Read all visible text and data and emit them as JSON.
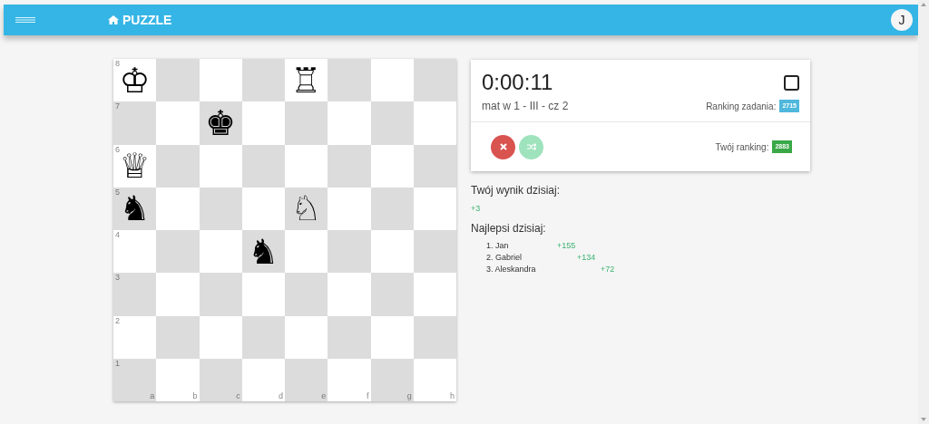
{
  "header": {
    "title": "PUZZLE",
    "avatar": "J"
  },
  "board": {
    "ranks": [
      "8",
      "7",
      "6",
      "5",
      "4",
      "3",
      "2",
      "1"
    ],
    "files": [
      "a",
      "b",
      "c",
      "d",
      "e",
      "f",
      "g",
      "h"
    ],
    "rows": [
      [
        {
          "piece": "♔"
        },
        {},
        {},
        {},
        {
          "piece": "♖"
        },
        {},
        {},
        {}
      ],
      [
        {},
        {},
        {
          "piece": "♚"
        },
        {},
        {},
        {},
        {},
        {}
      ],
      [
        {
          "piece": "♕"
        },
        {},
        {},
        {},
        {},
        {},
        {},
        {}
      ],
      [
        {
          "piece": "♞"
        },
        {},
        {},
        {},
        {
          "piece": "♘"
        },
        {},
        {},
        {}
      ],
      [
        {},
        {},
        {},
        {
          "piece": "♞"
        },
        {},
        {},
        {},
        {}
      ],
      [
        {},
        {},
        {},
        {},
        {},
        {},
        {},
        {}
      ],
      [
        {},
        {},
        {},
        {},
        {},
        {},
        {},
        {}
      ],
      [
        {},
        {},
        {},
        {},
        {},
        {},
        {},
        {}
      ]
    ]
  },
  "puzzle": {
    "timer": "0:00:11",
    "checkbox": {
      "checked": false
    },
    "name": "mat w 1 - III - cz 2",
    "task_ranking_label": "Ranking zadania:",
    "task_ranking": "2715",
    "your_ranking_label": "Twój ranking:",
    "your_ranking": "2883",
    "buttons": [
      {
        "kind": "give-up",
        "disabled": false
      },
      {
        "kind": "shuffle",
        "disabled": true
      }
    ]
  },
  "today": {
    "score_label": "Twój wynik dzisiaj:",
    "score": "+3",
    "best_label": "Najlepsi dzisiaj:",
    "best": [
      {
        "name": "1. Jan",
        "score": "+155"
      },
      {
        "name": "2. Gabriel",
        "score": "+134"
      },
      {
        "name": "3. Aleskandra",
        "score": "+72"
      }
    ]
  }
}
